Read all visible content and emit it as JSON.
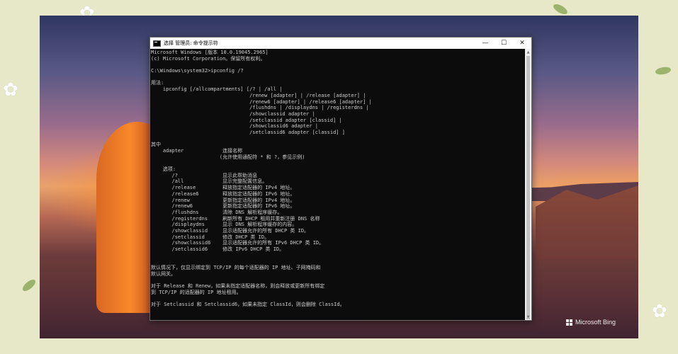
{
  "window": {
    "title": "选择 管理员: 命令提示符",
    "minimize_glyph": "—",
    "maximize_glyph": "☐",
    "close_glyph": "✕"
  },
  "console_lines": [
    "Microsoft Windows [版本 10.0.19045.2965]",
    "(c) Microsoft Corporation。保留所有权利。",
    "",
    "C:\\Windows\\system32>ipconfig /?",
    "",
    "用法:",
    "    ipconfig [/allcompartments] [/? | /all |",
    "                                 /renew [adapter] | /release [adapter] |",
    "                                 /renew6 [adapter] | /release6 [adapter] |",
    "                                 /flushdns | /displaydns | /registerdns |",
    "                                 /showclassid adapter |",
    "                                 /setclassid adapter [classid] |",
    "                                 /showclassid6 adapter |",
    "                                 /setclassid6 adapter [classid] ]",
    "",
    "其中",
    "    adapter             连接名称",
    "                       (允许使用通配符 * 和 ?，参见示例)",
    "",
    "    选项:",
    "       /?               显示此帮助消息",
    "       /all             显示完整配置信息。",
    "       /release         释放指定适配器的 IPv4 地址。",
    "       /release6        释放指定适配器的 IPv6 地址。",
    "       /renew           更新指定适配器的 IPv4 地址。",
    "       /renew6          更新指定适配器的 IPv6 地址。",
    "       /flushdns        清除 DNS 解析程序缓存。",
    "       /registerdns     刷新所有 DHCP 租用并重新注册 DNS 名称",
    "       /displaydns      显示 DNS 解析程序缓存的内容。",
    "       /showclassid     显示适配器允许的所有 DHCP 类 ID。",
    "       /setclassid      修改 DHCP 类 ID。",
    "       /showclassid6    显示适配器允许的所有 IPv6 DHCP 类 ID。",
    "       /setclassid6     修改 IPv6 DHCP 类 ID。",
    "",
    "",
    "默认情况下，仅显示绑定到 TCP/IP 的每个适配器的 IP 地址、子网掩码和",
    "默认网关。",
    "",
    "对于 Release 和 Renew，如果未指定适配器名称，则会释放或更新所有绑定",
    "到 TCP/IP 的适配器的 IP 地址租用。",
    "",
    "对于 Setclassid 和 Setclassid6，如果未指定 ClassId，则会删除 ClassId。"
  ],
  "watermark": {
    "text": "Microsoft Bing"
  },
  "icons": {
    "app": "cmd-icon",
    "flower": "✿"
  }
}
